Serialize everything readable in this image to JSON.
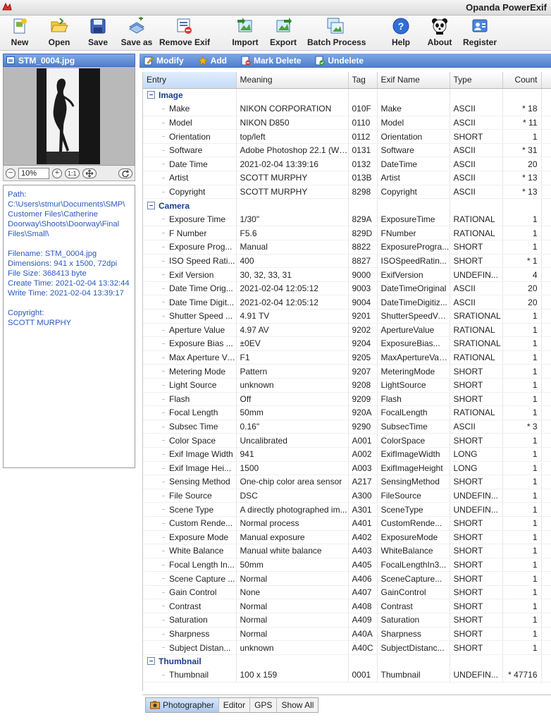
{
  "app": {
    "title": "Opanda PowerExif"
  },
  "toolbar": {
    "buttons": [
      {
        "label": "New",
        "icon": "new-file-icon"
      },
      {
        "label": "Open",
        "icon": "open-folder-icon"
      },
      {
        "label": "Save",
        "icon": "floppy-disk-icon"
      },
      {
        "label": "Save as",
        "icon": "save-as-icon"
      },
      {
        "label": "Remove Exif",
        "icon": "remove-exif-icon"
      },
      {
        "label": "Import",
        "icon": "import-icon"
      },
      {
        "label": "Export",
        "icon": "export-icon"
      },
      {
        "label": "Batch Process",
        "icon": "batch-process-icon"
      },
      {
        "label": "Help",
        "icon": "help-icon"
      },
      {
        "label": "About",
        "icon": "panda-icon"
      },
      {
        "label": "Register",
        "icon": "register-icon"
      }
    ]
  },
  "file_panel": {
    "filename": "STM_0004.jpg",
    "zoom": "10%",
    "fit_label": "1:1",
    "info": {
      "path": "Path: C:\\Users\\stmur\\Documents\\SMP\\Customer Files\\Catherine Doorway\\Shoots\\Doorway\\Final Files\\Small\\",
      "filename": "Filename: STM_0004.jpg",
      "dimensions": "Dimensions: 941 x 1500, 72dpi",
      "file_size": "File Size: 368413 byte",
      "create_time": "Create Time: 2021-02-04 13:32:44",
      "write_time": "Write Time: 2021-02-04 13:39:17",
      "copyright_label": "Copyright:",
      "copyright_value": "SCOTT MURPHY"
    }
  },
  "actions": [
    {
      "label": "Modify",
      "icon": "modify-icon"
    },
    {
      "label": "Add",
      "icon": "add-star-icon"
    },
    {
      "label": "Mark Delete",
      "icon": "mark-delete-icon"
    },
    {
      "label": "Undelete",
      "icon": "undelete-icon"
    }
  ],
  "table": {
    "columns": [
      "Entry",
      "Meaning",
      "Tag",
      "Exif Name",
      "Type",
      "Count"
    ],
    "groups": [
      {
        "name": "Image",
        "rows": [
          [
            "Make",
            "NIKON CORPORATION",
            "010F",
            "Make",
            "ASCII",
            "* 18"
          ],
          [
            "Model",
            "NIKON D850",
            "0110",
            "Model",
            "ASCII",
            "* 11"
          ],
          [
            "Orientation",
            "top/left",
            "0112",
            "Orientation",
            "SHORT",
            "1"
          ],
          [
            "Software",
            "Adobe Photoshop 22.1 (Wi...",
            "0131",
            "Software",
            "ASCII",
            "* 31"
          ],
          [
            "Date Time",
            "2021-02-04 13:39:16",
            "0132",
            "DateTime",
            "ASCII",
            "20"
          ],
          [
            "Artist",
            "SCOTT MURPHY",
            "013B",
            "Artist",
            "ASCII",
            "* 13"
          ],
          [
            "Copyright",
            "SCOTT MURPHY",
            "8298",
            "Copyright",
            "ASCII",
            "* 13"
          ]
        ]
      },
      {
        "name": "Camera",
        "rows": [
          [
            "Exposure Time",
            "1/30\"",
            "829A",
            "ExposureTime",
            "RATIONAL",
            "1"
          ],
          [
            "F Number",
            "F5.6",
            "829D",
            "FNumber",
            "RATIONAL",
            "1"
          ],
          [
            "Exposure Prog...",
            "Manual",
            "8822",
            "ExposureProgra...",
            "SHORT",
            "1"
          ],
          [
            "ISO Speed Rati...",
            "400",
            "8827",
            "ISOSpeedRatin...",
            "SHORT",
            "* 1"
          ],
          [
            "Exif Version",
            "30, 32, 33, 31",
            "9000",
            "ExifVersion",
            "UNDEFIN...",
            "4"
          ],
          [
            "Date Time Orig...",
            "2021-02-04 12:05:12",
            "9003",
            "DateTimeOriginal",
            "ASCII",
            "20"
          ],
          [
            "Date Time Digit...",
            "2021-02-04 12:05:12",
            "9004",
            "DateTimeDigitiz...",
            "ASCII",
            "20"
          ],
          [
            "Shutter Speed ...",
            "4.91 TV",
            "9201",
            "ShutterSpeedVa...",
            "SRATIONAL",
            "1"
          ],
          [
            "Aperture Value",
            "4.97 AV",
            "9202",
            "ApertureValue",
            "RATIONAL",
            "1"
          ],
          [
            "Exposure Bias ...",
            "±0EV",
            "9204",
            "ExposureBias...",
            "SRATIONAL",
            "1"
          ],
          [
            "Max Aperture Va...",
            "F1",
            "9205",
            "MaxApertureValue",
            "RATIONAL",
            "1"
          ],
          [
            "Metering Mode",
            "Pattern",
            "9207",
            "MeteringMode",
            "SHORT",
            "1"
          ],
          [
            "Light Source",
            "unknown",
            "9208",
            "LightSource",
            "SHORT",
            "1"
          ],
          [
            "Flash",
            "Off",
            "9209",
            "Flash",
            "SHORT",
            "1"
          ],
          [
            "Focal Length",
            "50mm",
            "920A",
            "FocalLength",
            "RATIONAL",
            "1"
          ],
          [
            "Subsec Time",
            "0.16\"",
            "9290",
            "SubsecTime",
            "ASCII",
            "* 3"
          ],
          [
            "Color Space",
            "Uncalibrated",
            "A001",
            "ColorSpace",
            "SHORT",
            "1"
          ],
          [
            "Exif Image Width",
            "941",
            "A002",
            "ExifImageWidth",
            "LONG",
            "1"
          ],
          [
            "Exif Image Hei...",
            "1500",
            "A003",
            "ExifImageHeight",
            "LONG",
            "1"
          ],
          [
            "Sensing Method",
            "One-chip color area sensor",
            "A217",
            "SensingMethod",
            "SHORT",
            "1"
          ],
          [
            "File Source",
            "DSC",
            "A300",
            "FileSource",
            "UNDEFIN...",
            "1"
          ],
          [
            "Scene Type",
            "A directly photographed im...",
            "A301",
            "SceneType",
            "UNDEFIN...",
            "1"
          ],
          [
            "Custom Rende...",
            "Normal process",
            "A401",
            "CustomRende...",
            "SHORT",
            "1"
          ],
          [
            "Exposure Mode",
            "Manual exposure",
            "A402",
            "ExposureMode",
            "SHORT",
            "1"
          ],
          [
            "White Balance",
            "Manual white balance",
            "A403",
            "WhiteBalance",
            "SHORT",
            "1"
          ],
          [
            "Focal Length In...",
            "50mm",
            "A405",
            "FocalLengthIn3...",
            "SHORT",
            "1"
          ],
          [
            "Scene Capture ...",
            "Normal",
            "A406",
            "SceneCapture...",
            "SHORT",
            "1"
          ],
          [
            "Gain Control",
            "None",
            "A407",
            "GainControl",
            "SHORT",
            "1"
          ],
          [
            "Contrast",
            "Normal",
            "A408",
            "Contrast",
            "SHORT",
            "1"
          ],
          [
            "Saturation",
            "Normal",
            "A409",
            "Saturation",
            "SHORT",
            "1"
          ],
          [
            "Sharpness",
            "Normal",
            "A40A",
            "Sharpness",
            "SHORT",
            "1"
          ],
          [
            "Subject Distan...",
            "unknown",
            "A40C",
            "SubjectDistanc...",
            "SHORT",
            "1"
          ]
        ]
      },
      {
        "name": "Thumbnail",
        "rows": [
          [
            "Thumbnail",
            "100 x 159",
            "0001",
            "Thumbnail",
            "UNDEFIN...",
            "* 47716"
          ]
        ]
      }
    ]
  },
  "tabs": [
    {
      "label": "Photographer",
      "active": true
    },
    {
      "label": "Editor",
      "active": false
    },
    {
      "label": "GPS",
      "active": false
    },
    {
      "label": "Show All",
      "active": false
    }
  ]
}
